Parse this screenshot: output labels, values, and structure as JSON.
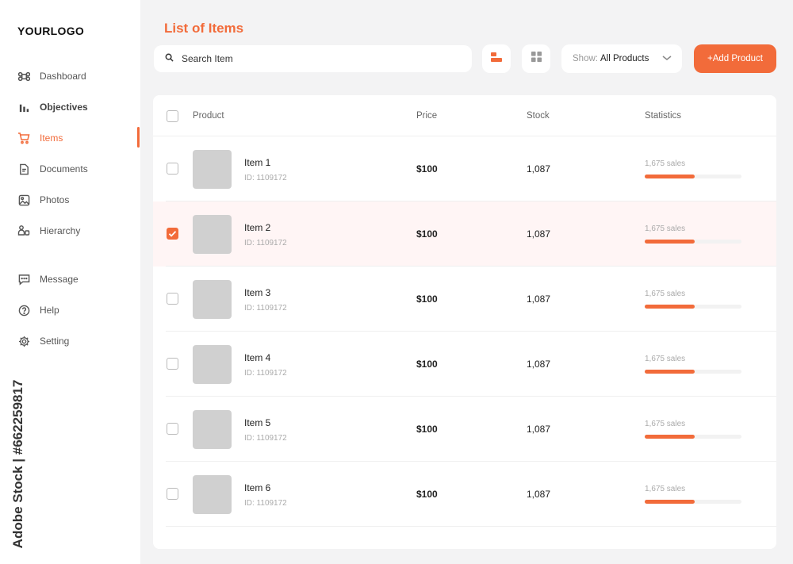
{
  "logo": "YOURLOGO",
  "sidebar": {
    "items": [
      {
        "label": "Dashboard",
        "icon": "command-icon"
      },
      {
        "label": "Objectives",
        "icon": "bar-chart-icon"
      },
      {
        "label": "Items",
        "icon": "cart-icon"
      },
      {
        "label": "Documents",
        "icon": "document-icon"
      },
      {
        "label": "Photos",
        "icon": "photo-icon"
      },
      {
        "label": "Hierarchy",
        "icon": "hierarchy-icon"
      },
      {
        "label": "Message",
        "icon": "message-icon"
      },
      {
        "label": "Help",
        "icon": "help-icon"
      },
      {
        "label": "Setting",
        "icon": "gear-icon"
      }
    ],
    "active": "Items"
  },
  "watermark_id": "Adobe Stock | #662259817",
  "header": {
    "title": "List of Items",
    "search_placeholder": "Search Item",
    "show_label": "Show:",
    "show_value": "All Products",
    "add_label": "+Add Product"
  },
  "table": {
    "columns": [
      "Product",
      "Price",
      "Stock",
      "Statistics"
    ],
    "rows": [
      {
        "name": "Item 1",
        "id": "ID: 1109172",
        "price": "$100",
        "stock": "1,087",
        "sales": "1,675 sales",
        "progress": 0.52,
        "checked": false
      },
      {
        "name": "Item 2",
        "id": "ID: 1109172",
        "price": "$100",
        "stock": "1,087",
        "sales": "1,675 sales",
        "progress": 0.52,
        "checked": true
      },
      {
        "name": "Item 3",
        "id": "ID: 1109172",
        "price": "$100",
        "stock": "1,087",
        "sales": "1,675 sales",
        "progress": 0.52,
        "checked": false
      },
      {
        "name": "Item 4",
        "id": "ID: 1109172",
        "price": "$100",
        "stock": "1,087",
        "sales": "1,675 sales",
        "progress": 0.52,
        "checked": false
      },
      {
        "name": "Item 5",
        "id": "ID: 1109172",
        "price": "$100",
        "stock": "1,087",
        "sales": "1,675 sales",
        "progress": 0.52,
        "checked": false
      },
      {
        "name": "Item 6",
        "id": "ID: 1109172",
        "price": "$100",
        "stock": "1,087",
        "sales": "1,675 sales",
        "progress": 0.52,
        "checked": false
      }
    ]
  },
  "colors": {
    "accent": "#f26b3a",
    "selected_row": "#fff5f5"
  }
}
